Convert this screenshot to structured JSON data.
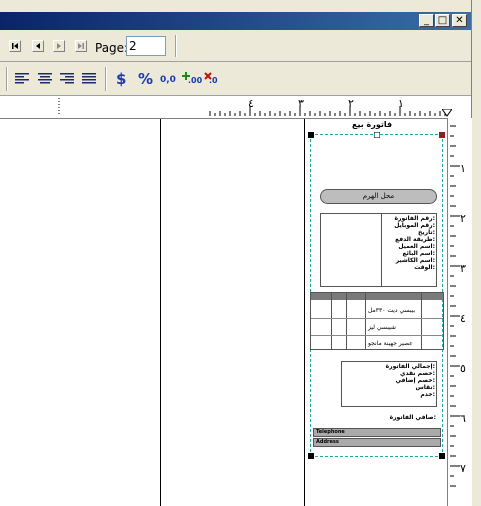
{
  "window": {
    "minimize": "_",
    "maximize": "□",
    "close": "✕"
  },
  "toolbar": {
    "page_label": "Page:",
    "page_value": "2",
    "nav": [
      "first-page-icon",
      "prev-page-icon",
      "next-page-icon",
      "last-page-icon"
    ],
    "format_icons": [
      "align-left-icon",
      "align-center-icon",
      "align-right-icon",
      "justify-icon",
      "currency-icon",
      "percent-icon",
      "decimal-icon",
      "add-decimal-icon",
      "remove-decimal-icon"
    ],
    "currency_glyph": "$",
    "percent_glyph": "%",
    "decimal_glyph": "0,0",
    "add_decimal_glyph": ".00",
    "remove_decimal_glyph": ".0"
  },
  "ruler": {
    "h_labels": [
      "٤",
      "٣",
      "٢",
      "١"
    ],
    "v_labels": [
      "١",
      "٢",
      "٣",
      "٤",
      "٥",
      "٦",
      "٧"
    ]
  },
  "report": {
    "title": "فاتورة بيع",
    "shop_name": "محل الهرم",
    "info_labels": [
      "رقم الفاتورة:",
      "رقم الموبايل:",
      "تاريخ:",
      "طريقة الدفع:",
      "اسم العميل:",
      "اسم البائع:",
      "اسم الكاشير:",
      "الوقت:"
    ],
    "items": [
      "بيبسي ديت ٣٣٠مل",
      "شيبسي ليز",
      "عصير جهينة مانجو"
    ],
    "totals_labels": [
      "إجمالي الفاتورة:",
      "خصم نقدي:",
      "خصم إضافي:",
      "نقاس:",
      "خدم:"
    ],
    "net_label": "صافي الفاتورة:",
    "telephone_label": "Telephone",
    "address_label": "Address"
  }
}
